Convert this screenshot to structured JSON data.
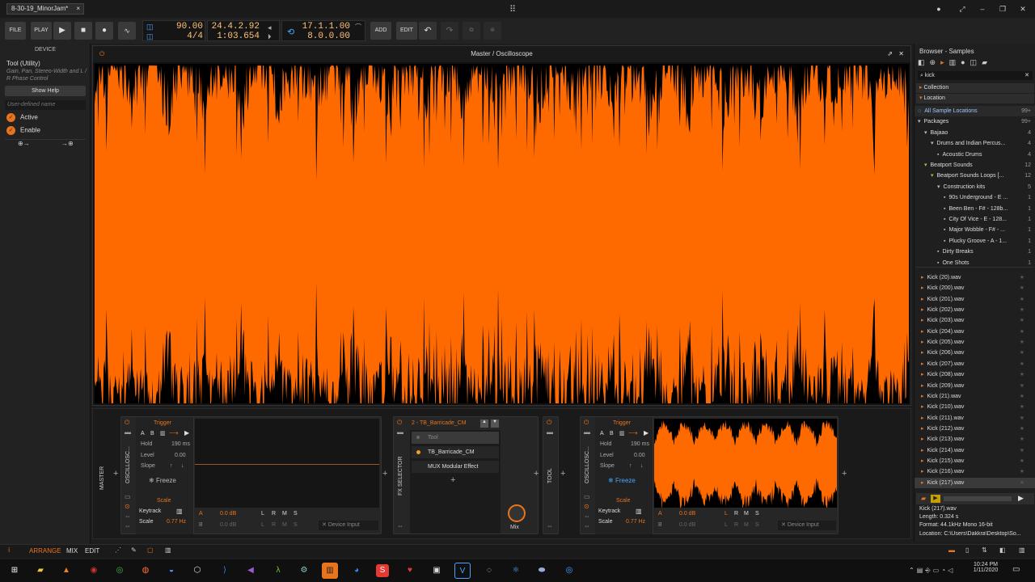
{
  "window": {
    "tab_title": "8-30-19_MinorJam*",
    "tab_close": "×",
    "center_icon": "⠿",
    "controls": [
      "●",
      "⤢",
      "–",
      "❐",
      "✕"
    ]
  },
  "transport": {
    "file": "FILE",
    "play_label": "PLAY",
    "tempo": "90.00",
    "meter": "4/4",
    "pos_bars": "24.4.2.92",
    "pos_time": "1:03.654",
    "loop_start": "17.1.1.00",
    "loop_len": "8.0.0.00",
    "add": "ADD",
    "edit": "EDIT"
  },
  "device_panel": {
    "header": "DEVICE",
    "title": "Tool (Utility)",
    "desc": "Gain, Pan, Stereo-Width and L / R Phase Control",
    "show_help": "Show Help",
    "user_name_placeholder": "User-defined name",
    "active": "Active",
    "enable": "Enable"
  },
  "scope": {
    "title": "Master / Oscilloscope"
  },
  "chain": {
    "master": "MASTER",
    "oscillo1": "OSCILLOSC...",
    "trigger": "Trigger",
    "a": "A",
    "b": "B",
    "hold": "Hold",
    "hold_val": "190 ms",
    "level": "Level",
    "level_val": "0.00",
    "slope": "Slope",
    "freeze": "Freeze",
    "scale_hdr": "Scale",
    "keytrack": "Keytrack",
    "scale": "Scale",
    "scale_val": "0.77 Hz",
    "a_db": "0.0 dB",
    "b_db": "0.0 dB",
    "l": "L",
    "r": "R",
    "m": "M",
    "s": "S",
    "device_input": "Device Input",
    "fx_selector": "FX SELECTOR",
    "fx_title": "2 - TB_Barricade_CM",
    "fx_items": [
      "Tool",
      "TB_Barricade_CM",
      "MUX Modular Effect"
    ],
    "mix": "Mix",
    "tool": "TOOL",
    "oscillo2": "OSCILLOSC..."
  },
  "browser": {
    "title": "Browser - Samples",
    "search": "kick",
    "collection": "Collection",
    "location": "Location",
    "tree": [
      {
        "label": "All Sample Locations",
        "count": "99+",
        "indent": 4,
        "icon": "○"
      },
      {
        "label": "Packages",
        "count": "99+",
        "indent": 4,
        "icon": "▾"
      },
      {
        "label": "Bajaao",
        "count": "4",
        "indent": 12,
        "icon": "▾"
      },
      {
        "label": "Drums and Indian Percus...",
        "count": "4",
        "indent": 20,
        "icon": "▾"
      },
      {
        "label": "Acoustic Drums",
        "count": "4",
        "indent": 28,
        "icon": "▪"
      },
      {
        "label": "Beatport Sounds",
        "count": "12",
        "indent": 12,
        "icon": "▾"
      },
      {
        "label": "Beatport Sounds Loops [...",
        "count": "12",
        "indent": 20,
        "icon": "▾"
      },
      {
        "label": "Construction kits",
        "count": "5",
        "indent": 28,
        "icon": "▾"
      },
      {
        "label": "90s Underground - E ...",
        "count": "1",
        "indent": 36,
        "icon": "▪"
      },
      {
        "label": "Been Ben - F# - 128b...",
        "count": "1",
        "indent": 36,
        "icon": "▪"
      },
      {
        "label": "City Of Vice - E - 128...",
        "count": "1",
        "indent": 36,
        "icon": "▪"
      },
      {
        "label": "Major Wobble - F# - ...",
        "count": "1",
        "indent": 36,
        "icon": "▪"
      },
      {
        "label": "Plucky Groove - A - 1...",
        "count": "1",
        "indent": 36,
        "icon": "▪"
      },
      {
        "label": "Dirty Breaks",
        "count": "1",
        "indent": 28,
        "icon": "▪"
      },
      {
        "label": "One Shots",
        "count": "1",
        "indent": 28,
        "icon": "▪"
      }
    ],
    "files": [
      "Kick (20).wav",
      "Kick (200).wav",
      "Kick (201).wav",
      "Kick (202).wav",
      "Kick (203).wav",
      "Kick (204).wav",
      "Kick (205).wav",
      "Kick (206).wav",
      "Kick (207).wav",
      "Kick (208).wav",
      "Kick (209).wav",
      "Kick (21).wav",
      "Kick (210).wav",
      "Kick (211).wav",
      "Kick (212).wav",
      "Kick (213).wav",
      "Kick (214).wav",
      "Kick (215).wav",
      "Kick (216).wav",
      "Kick (217).wav"
    ],
    "info_name": "Kick (217).wav",
    "info_length": "Length: 0.324 s",
    "info_format": "Format: 44.1kHz Mono 16-bit",
    "info_location": "Location: C:\\Users\\Dakkra\\Desktop\\So..."
  },
  "bottom": {
    "arrange": "ARRANGE",
    "mix": "MIX",
    "edit": "EDIT"
  },
  "taskbar": {
    "time": "10:24 PM",
    "date": "1/11/2020"
  },
  "colors": {
    "accent": "#e8741c",
    "wave": "#ff6a00"
  }
}
